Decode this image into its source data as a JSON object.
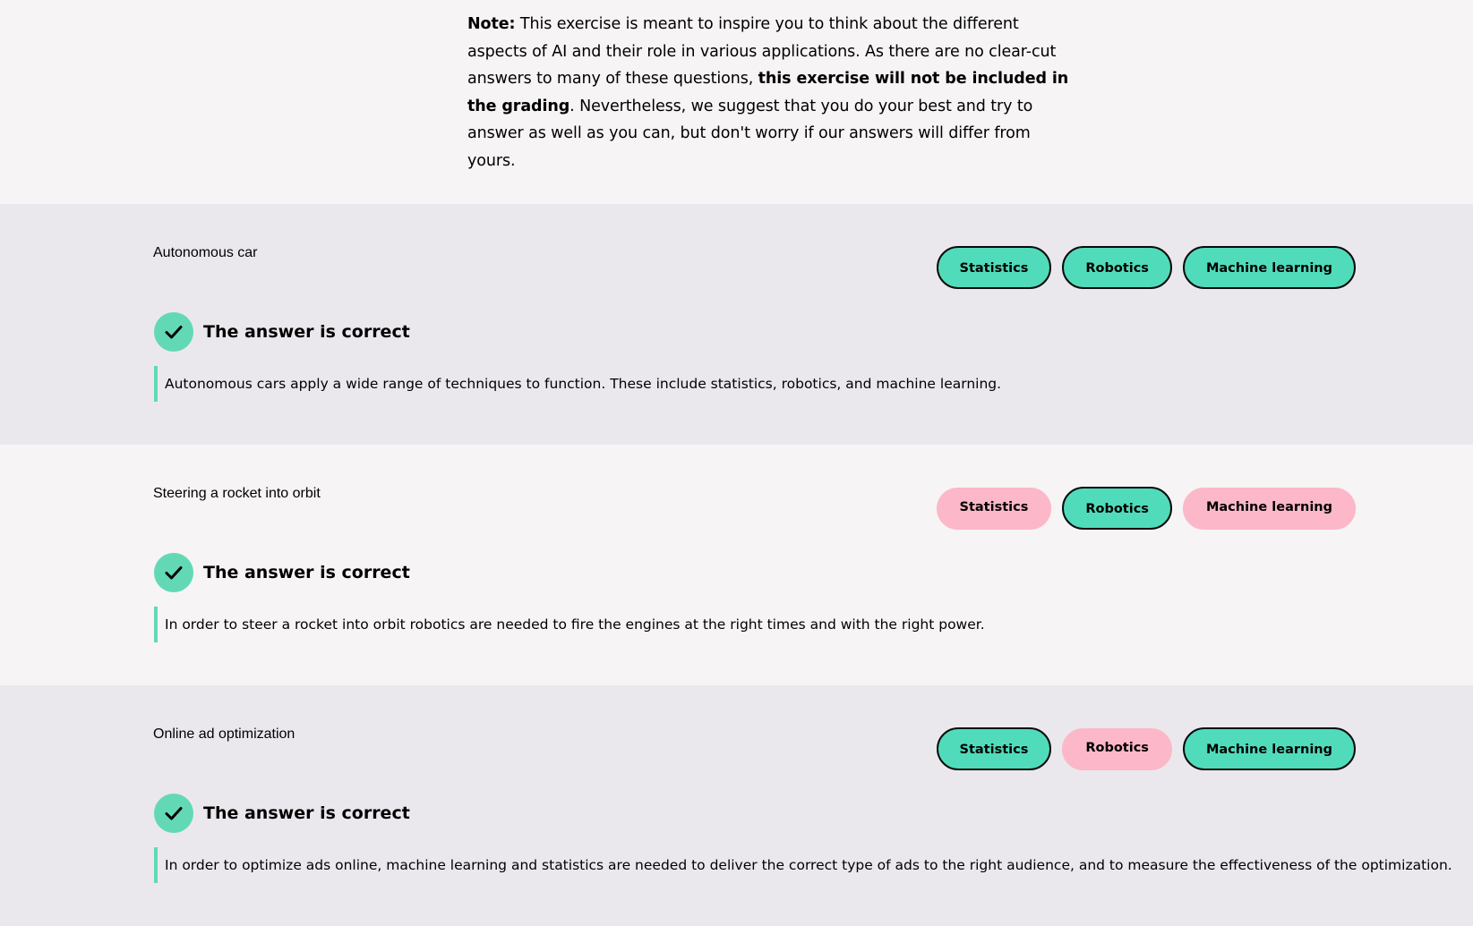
{
  "note": {
    "label": "Note:",
    "text_1": " This exercise is meant to inspire you to think about the different aspects of AI and their role in various applications. As there are no clear-cut answers to many of these questions, ",
    "bold": "this exercise will not be included in the grading",
    "text_2": ". Nevertheless, we suggest that you do your best and try to answer as well as you can, but don't worry if our answers will differ from yours."
  },
  "questions": [
    {
      "title": "Autonomous car",
      "options": [
        {
          "label": "Statistics",
          "selected": true
        },
        {
          "label": "Robotics",
          "selected": true
        },
        {
          "label": "Machine learning",
          "selected": true
        }
      ],
      "result": "The answer is correct",
      "explanation": "Autonomous cars apply a wide range of techniques to function. These include statistics, robotics, and machine learning."
    },
    {
      "title": "Steering a rocket into orbit",
      "options": [
        {
          "label": "Statistics",
          "selected": false
        },
        {
          "label": "Robotics",
          "selected": true
        },
        {
          "label": "Machine learning",
          "selected": false
        }
      ],
      "result": "The answer is correct",
      "explanation": "In order to steer a rocket into orbit robotics are needed to fire the engines at the right times and with the right power."
    },
    {
      "title": "Online ad optimization",
      "options": [
        {
          "label": "Statistics",
          "selected": true
        },
        {
          "label": "Robotics",
          "selected": false
        },
        {
          "label": "Machine learning",
          "selected": true
        }
      ],
      "result": "The answer is correct",
      "explanation": "In order to optimize ads online, machine learning and statistics are needed to deliver the correct type of ads to the right audience, and to measure the effectiveness of the optimization."
    }
  ],
  "colors": {
    "selected_chip": "#50dcbb",
    "unselected_chip": "#fcb8c8",
    "check": "#62d9b4",
    "alt_bg": "#ebe8ed",
    "page_bg": "#f6f4f5"
  },
  "icons": {
    "result": "checkmark-icon"
  }
}
